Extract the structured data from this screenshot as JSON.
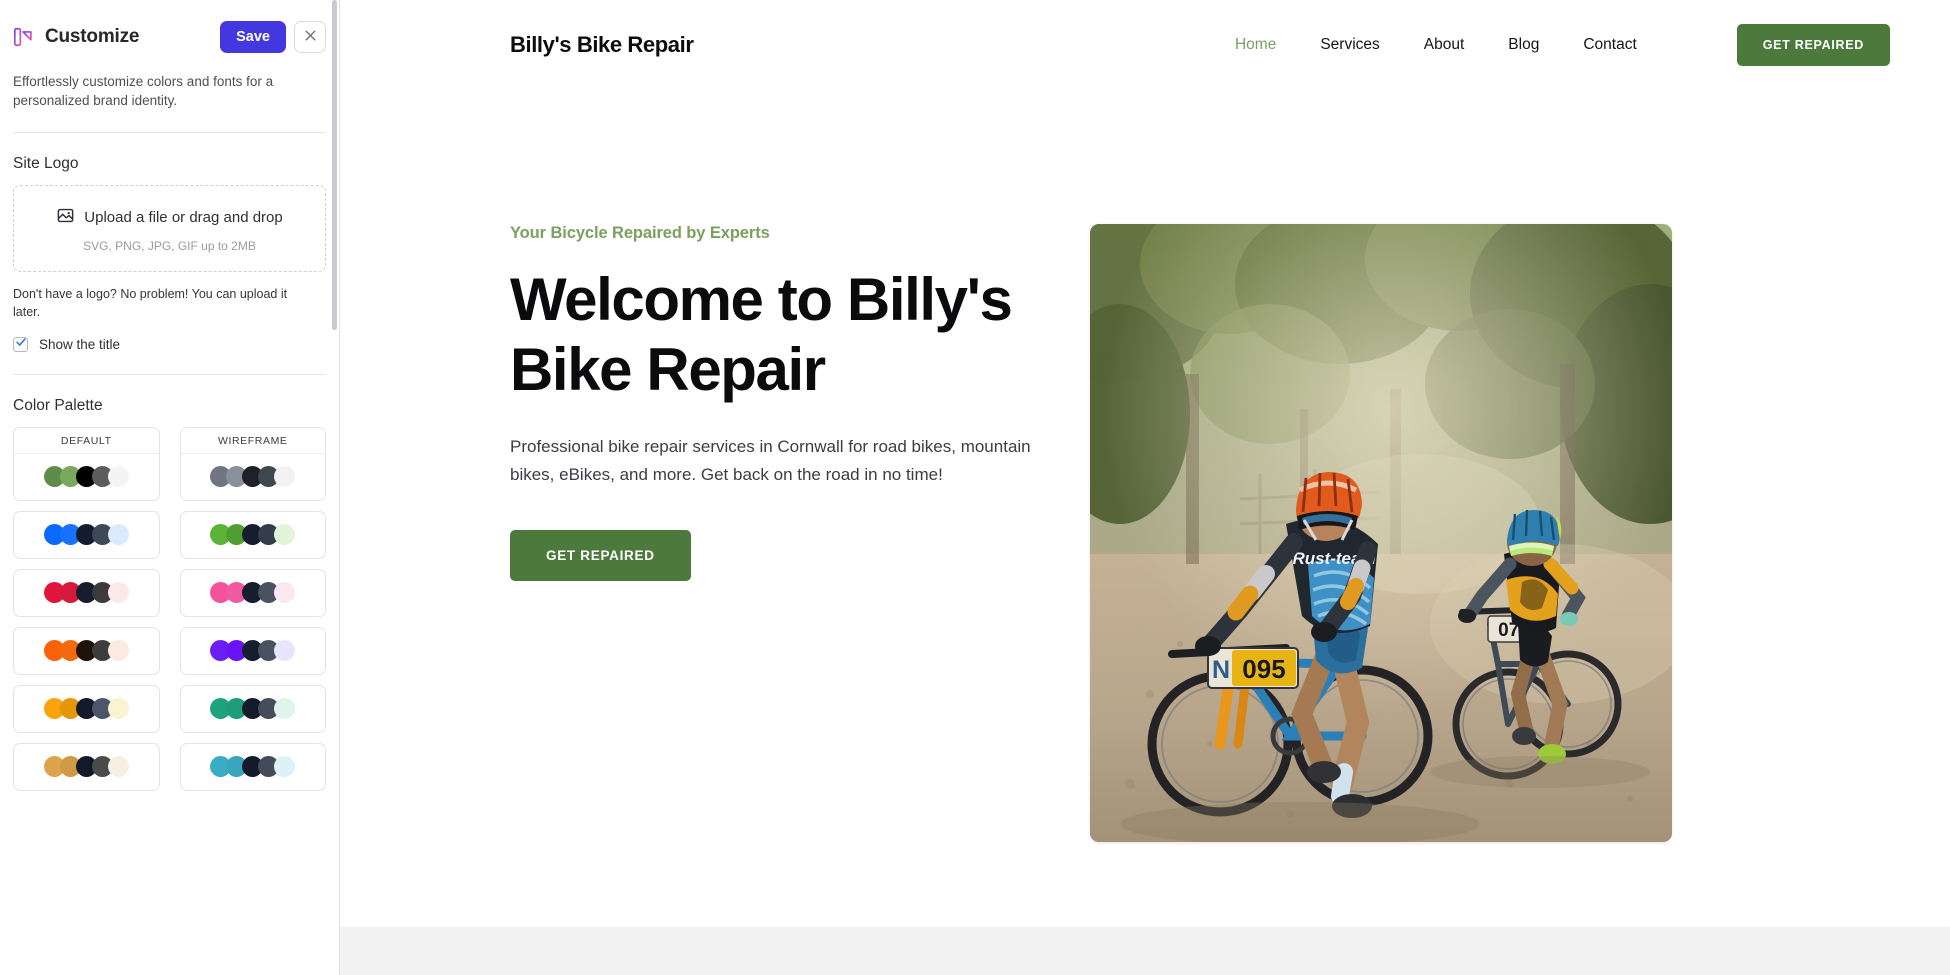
{
  "sidebar": {
    "title": "Customize",
    "logo_icon": "customize-brand-icon",
    "save_label": "Save",
    "close_icon": "close-icon",
    "description": "Effortlessly customize colors and fonts for a personalized brand identity.",
    "site_logo": {
      "section_label": "Site Logo",
      "upload_icon": "image-upload-icon",
      "upload_label": "Upload a file or drag and drop",
      "upload_hint": "SVG, PNG, JPG, GIF up to 2MB",
      "no_logo_hint": "Don't have a logo? No problem! You can upload it later.",
      "show_title_label": "Show the title",
      "show_title_checked": true,
      "check_icon": "checkmark-icon"
    },
    "color_palette": {
      "section_label": "Color Palette",
      "palettes": [
        {
          "name": "DEFAULT",
          "swatches": [
            "#5f8c4b",
            "#7aa85f",
            "#000000",
            "#5c5c5c",
            "#f4f4f4"
          ]
        },
        {
          "name": "WIREFRAME",
          "swatches": [
            "#6f7682",
            "#8a919c",
            "#202027",
            "#41474f",
            "#f2f2f3"
          ]
        },
        {
          "name": "",
          "swatches": [
            "#0a6aff",
            "#1773ff",
            "#131d2e",
            "#3e4857",
            "#dbeaff"
          ]
        },
        {
          "name": "",
          "swatches": [
            "#5bb33a",
            "#4f9e31",
            "#161d2d",
            "#343d4b",
            "#e2f5da"
          ]
        },
        {
          "name": "",
          "swatches": [
            "#e0143c",
            "#d41a3c",
            "#161d2d",
            "#3b3b3d",
            "#fbe9e9"
          ]
        },
        {
          "name": "",
          "swatches": [
            "#f4529b",
            "#f05aa0",
            "#161d2d",
            "#4a5261",
            "#fbe7ef"
          ]
        },
        {
          "name": "",
          "swatches": [
            "#fb6108",
            "#f26a0d",
            "#1f1208",
            "#3d3c3b",
            "#fceae0"
          ]
        },
        {
          "name": "",
          "swatches": [
            "#6b1ff5",
            "#6a13f7",
            "#161d2d",
            "#4a5261",
            "#e7e4fd"
          ]
        },
        {
          "name": "",
          "swatches": [
            "#f9a409",
            "#e39709",
            "#131a2a",
            "#4d5668",
            "#fbf2d2"
          ]
        },
        {
          "name": "",
          "swatches": [
            "#1fa37e",
            "#1e9d79",
            "#141b2a",
            "#454d5c",
            "#e0f3ec"
          ]
        },
        {
          "name": "",
          "swatches": [
            "#dca44c",
            "#cf9a47",
            "#121929",
            "#4b4b4b",
            "#f6efe2"
          ]
        },
        {
          "name": "",
          "swatches": [
            "#3aacc4",
            "#3aa6be",
            "#131a2a",
            "#444c5b",
            "#ddf2f6"
          ]
        }
      ]
    }
  },
  "preview": {
    "brand": "Billy's Bike Repair",
    "nav": [
      {
        "label": "Home",
        "active": true
      },
      {
        "label": "Services",
        "active": false
      },
      {
        "label": "About",
        "active": false
      },
      {
        "label": "Blog",
        "active": false
      },
      {
        "label": "Contact",
        "active": false
      }
    ],
    "header_cta": "GET REPAIRED",
    "hero": {
      "eyebrow": "Your Bicycle Repaired by Experts",
      "title_line1": "Welcome to Billy's",
      "title_line2": "Bike Repair",
      "subtitle": "Professional bike repair services in Cornwall for road bikes, mountain bikes, eBikes, and more. Get back on the road in no time!",
      "cta": "GET REPAIRED",
      "image_alt": "Two mountain bikers racing on a dusty forest trail"
    }
  },
  "colors": {
    "accent_green": "#4b7a3c",
    "eyebrow_green": "#7aa05f",
    "save_purple": "#4338e0"
  }
}
